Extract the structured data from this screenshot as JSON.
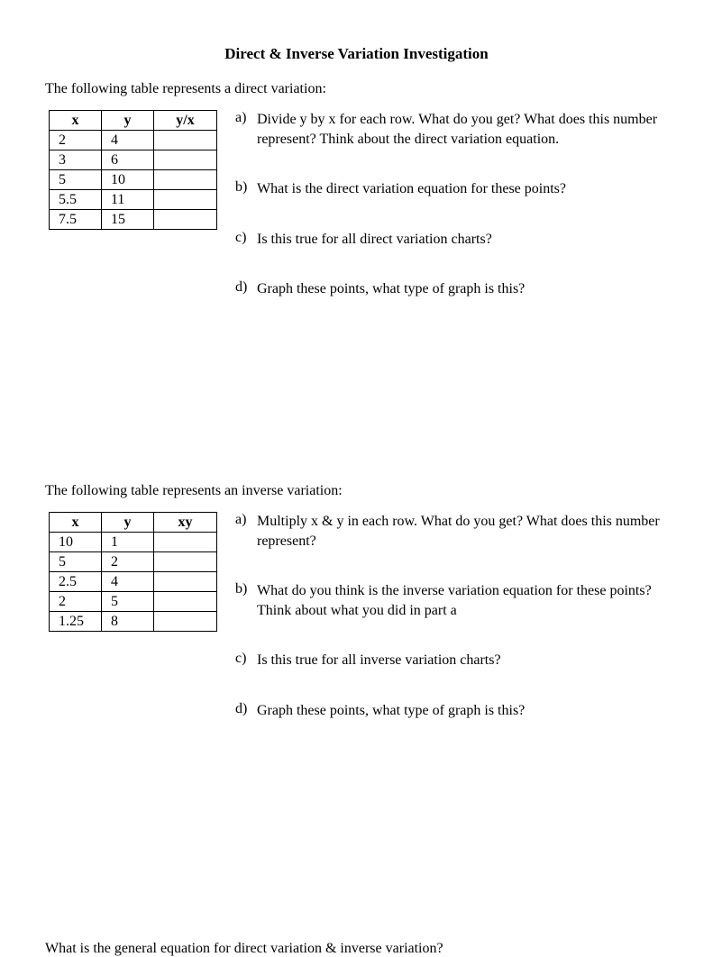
{
  "title": "Direct & Inverse Variation Investigation",
  "section1": {
    "intro": "The following table represents a direct variation:",
    "headers": {
      "c1": "x",
      "c2": "y",
      "c3": "y/x"
    },
    "rows": [
      {
        "c1": "2",
        "c2": "4",
        "c3": ""
      },
      {
        "c1": "3",
        "c2": "6",
        "c3": ""
      },
      {
        "c1": "5",
        "c2": "10",
        "c3": ""
      },
      {
        "c1": "5.5",
        "c2": "11",
        "c3": ""
      },
      {
        "c1": "7.5",
        "c2": "15",
        "c3": ""
      }
    ],
    "questions": [
      {
        "letter": "a)",
        "text": "Divide y by x for each row. What do you get? What does this number represent? Think about the direct variation equation."
      },
      {
        "letter": "b)",
        "text": "What is the direct variation equation for these points?"
      },
      {
        "letter": "c)",
        "text": "Is this true for all direct variation charts?"
      },
      {
        "letter": "d)",
        "text": "Graph these points, what type of graph is this?"
      }
    ]
  },
  "section2": {
    "intro": "The following table represents an inverse variation:",
    "headers": {
      "c1": "x",
      "c2": "y",
      "c3": "xy"
    },
    "rows": [
      {
        "c1": "10",
        "c2": "1",
        "c3": ""
      },
      {
        "c1": "5",
        "c2": "2",
        "c3": ""
      },
      {
        "c1": "2.5",
        "c2": "4",
        "c3": ""
      },
      {
        "c1": "2",
        "c2": "5",
        "c3": ""
      },
      {
        "c1": "1.25",
        "c2": "8",
        "c3": ""
      }
    ],
    "questions": [
      {
        "letter": "a)",
        "text": "Multiply x & y in each row. What do you get? What does this number represent?"
      },
      {
        "letter": "b)",
        "text": "What do you think is the inverse variation equation for these points? Think about what you did in part a"
      },
      {
        "letter": "c)",
        "text": "Is this true for all inverse variation charts?"
      },
      {
        "letter": "d)",
        "text": "Graph these points, what type of graph is this?"
      }
    ]
  },
  "finalQuestion": "What is the general equation for direct variation & inverse variation?"
}
